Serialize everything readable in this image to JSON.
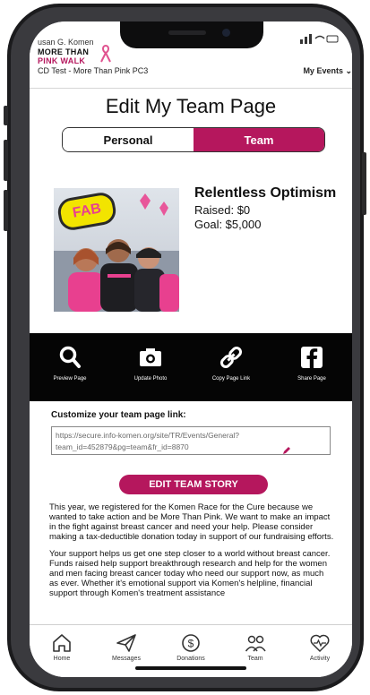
{
  "header": {
    "org_partial": "usan G. Komen",
    "logo_line1": "MORE THAN",
    "logo_line2": "PINK WALK",
    "event_name": "CD Test - More Than Pink PC3",
    "my_events": "My Events ⌄"
  },
  "page": {
    "title": "Edit My Team Page",
    "toggle": {
      "personal": "Personal",
      "team": "Team",
      "selected": "Team"
    }
  },
  "team": {
    "name": "Relentless Optimism",
    "raised": "Raised: $0",
    "goal": "Goal: $5,000",
    "photo_sign": "FAB"
  },
  "actions": [
    {
      "label": "Preview Page",
      "icon": "search-icon"
    },
    {
      "label": "Update Photo",
      "icon": "camera-icon"
    },
    {
      "label": "Copy Page Link",
      "icon": "link-icon"
    },
    {
      "label": "Share Page",
      "icon": "facebook-icon"
    }
  ],
  "link_section": {
    "label": "Customize your team page link:",
    "url": "https://secure.info-komen.org/site/TR/Events/General?team_id=452879&pg=team&fr_id=8870"
  },
  "edit_story_button": "EDIT TEAM STORY",
  "story": {
    "p1": "This year, we registered for the Komen Race for the Cure because we wanted to take action and be More Than Pink. We want to make an impact in the fight against breast cancer and need your help. Please consider making a tax-deductible donation today in support of our fundraising efforts.",
    "p2": "Your support helps us get one step closer to a world without breast cancer. Funds raised help support breakthrough research and help for the women and men facing breast cancer today who need our support now, as much as ever. Whether it's emotional support via Komen's helpline, financial support through Komen's treatment assistance"
  },
  "tabs": [
    {
      "label": "Home",
      "icon": "home-icon"
    },
    {
      "label": "Messages",
      "icon": "send-icon"
    },
    {
      "label": "Donations",
      "icon": "dollar-icon"
    },
    {
      "label": "Team",
      "icon": "team-icon"
    },
    {
      "label": "Activity",
      "icon": "heartbeat-icon"
    }
  ],
  "colors": {
    "accent": "#b5175d",
    "action_bar": "#050505"
  }
}
